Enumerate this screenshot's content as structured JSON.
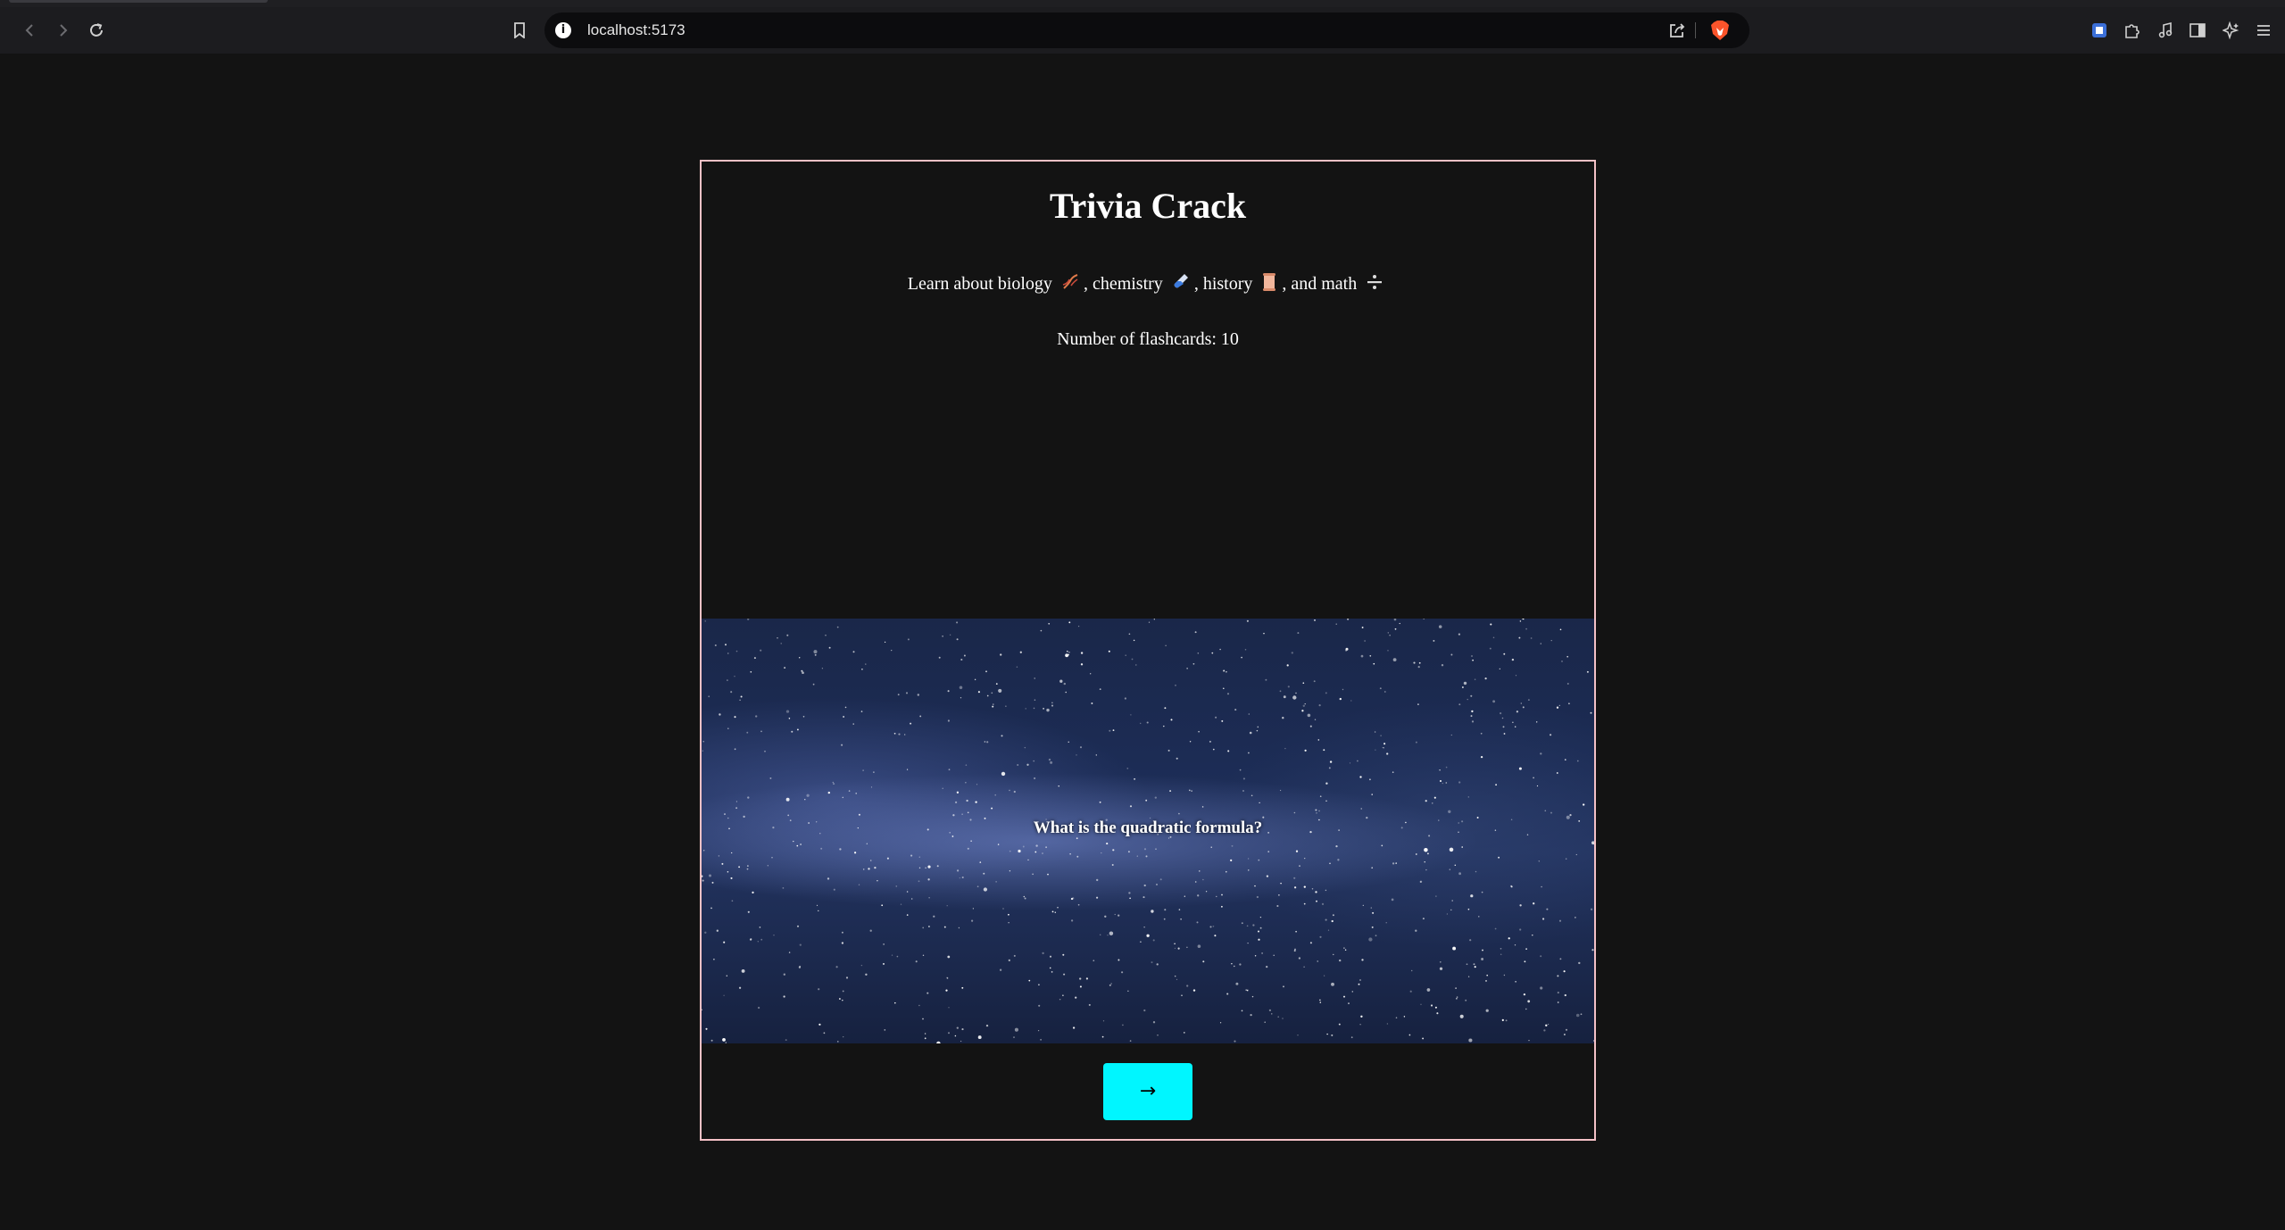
{
  "browser": {
    "url": "localhost:5173"
  },
  "page": {
    "title": "Trivia Crack",
    "subtitle_parts": {
      "learn": "Learn about biology",
      "chemistry": ", chemistry",
      "history": ", history",
      "math": ", and math"
    },
    "subtitle_icons": [
      "dna-icon",
      "test-tube-icon",
      "scroll-icon",
      "divide-icon"
    ],
    "flashcard_count": "Number of flashcards: 10",
    "flashcard": {
      "question": "What is the quadratic formula?"
    },
    "next_button_label": "→"
  },
  "colors": {
    "background": "#131313",
    "frame_border": "#f4c1c6",
    "next_button": "#00f6ff"
  }
}
